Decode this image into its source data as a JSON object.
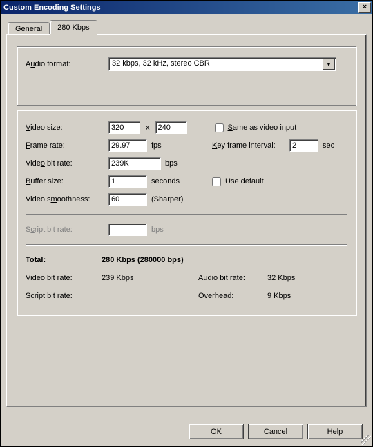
{
  "window": {
    "title": "Custom Encoding Settings",
    "close": "×"
  },
  "tabs": {
    "general": "General",
    "bitrate": "280 Kbps"
  },
  "audio": {
    "format_label_pre": "A",
    "format_label_u": "u",
    "format_label_post": "dio format:",
    "format_value": "32 kbps, 32 kHz, stereo CBR"
  },
  "video": {
    "size_label_u": "V",
    "size_label_post": "ideo size:",
    "width": "320",
    "x": "x",
    "height": "240",
    "same_as_input_u": "S",
    "same_as_input_post": "ame as video input",
    "frame_u": "F",
    "frame_post": "rame rate:",
    "frame_value": "29.97",
    "fps": "fps",
    "key_interval_u": "K",
    "key_interval_post": "ey frame interval:",
    "key_interval_value": "2",
    "sec": "sec",
    "bitrate_label_pre": "Vide",
    "bitrate_label_u": "o",
    "bitrate_label_post": " bit rate:",
    "bitrate_value": "239K",
    "bps": "bps",
    "buffer_u": "B",
    "buffer_post": "uffer size:",
    "buffer_value": "1",
    "seconds": "seconds",
    "use_default": "Use default",
    "smooth_label_pre": "Video s",
    "smooth_label_u": "m",
    "smooth_label_post": "oothness:",
    "smooth_value": "60",
    "sharper": "(Sharper)"
  },
  "script": {
    "label_pre": "S",
    "label_u": "c",
    "label_post": "ript bit rate:",
    "bps": "bps"
  },
  "summary": {
    "total_label": "Total:",
    "total_value": "280 Kbps (280000 bps)",
    "vbr_label": "Video bit rate:",
    "vbr_value": "239 Kbps",
    "abr_label": "Audio bit rate:",
    "abr_value": "32 Kbps",
    "sbr_label": "Script bit rate:",
    "sbr_value": "",
    "ovh_label": "Overhead:",
    "ovh_value": "9 Kbps"
  },
  "buttons": {
    "ok": "OK",
    "cancel": "Cancel",
    "help_u": "H",
    "help_post": "elp"
  }
}
